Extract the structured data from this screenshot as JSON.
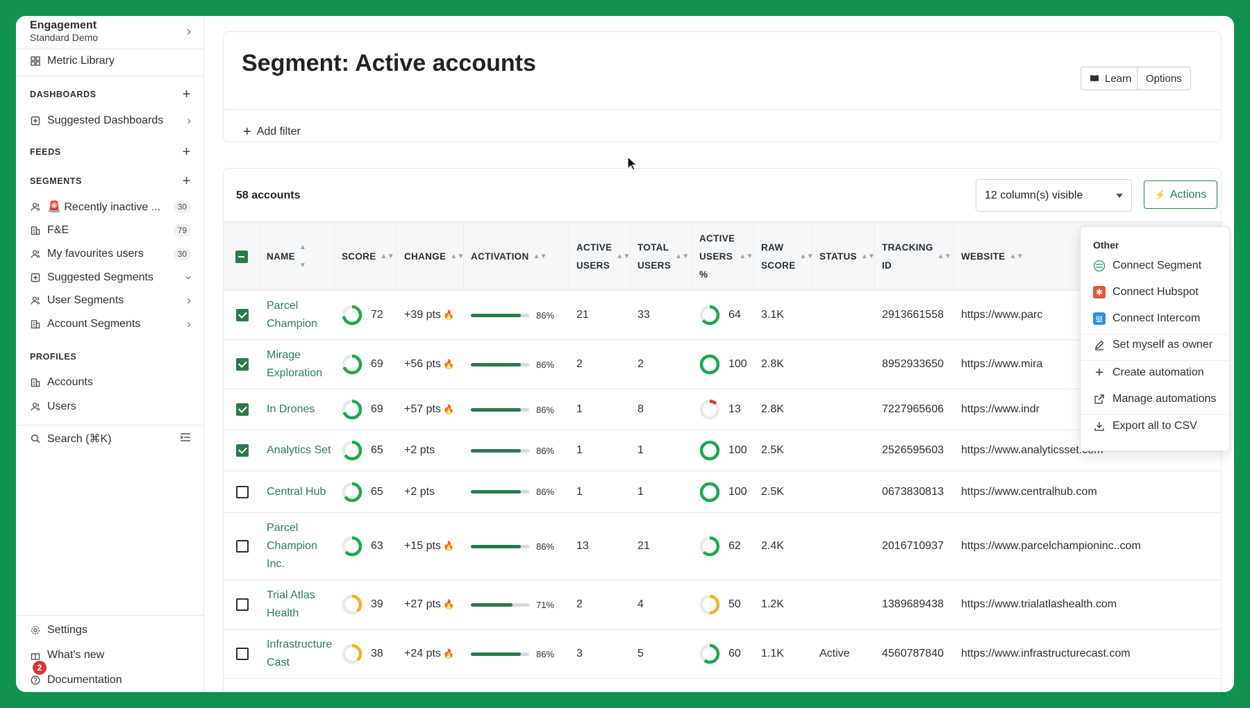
{
  "sidebar": {
    "workspace_name": "Engagement",
    "workspace_sub": "Standard Demo",
    "metric_library": "Metric Library",
    "dashboards_title": "DASHBOARDS",
    "suggested_dashboards": "Suggested Dashboards",
    "feeds_title": "FEEDS",
    "segments_title": "SEGMENTS",
    "segments": [
      {
        "label": "🚨 Recently inactive ...",
        "count": "30"
      },
      {
        "label": "F&E",
        "count": "79"
      },
      {
        "label": "My favourites users",
        "count": "30"
      },
      {
        "label": "Suggested Segments"
      },
      {
        "label": "User Segments"
      },
      {
        "label": "Account Segments"
      }
    ],
    "profiles_title": "PROFILES",
    "accounts": "Accounts",
    "users": "Users",
    "search": "Search (⌘K)",
    "settings": "Settings",
    "whats_new": "What's new",
    "whats_new_badge": "2",
    "documentation": "Documentation"
  },
  "header": {
    "title": "Segment: Active accounts",
    "learn": "Learn",
    "options": "Options",
    "add_filter": "Add filter"
  },
  "table": {
    "count_label": "58 accounts",
    "columns_visible": "12 column(s) visible",
    "actions": "Actions",
    "headers": {
      "name": "NAME",
      "score": "SCORE",
      "change": "CHANGE",
      "activation": "ACTIVATION",
      "active_users_1": "ACTIVE",
      "active_users_2": "USERS",
      "total_users_1": "TOTAL",
      "total_users_2": "USERS",
      "active_pct_1": "ACTIVE",
      "active_pct_2": "USERS",
      "active_pct_3": "%",
      "raw_score_1": "RAW",
      "raw_score_2": "SCORE",
      "status": "STATUS",
      "tracking_1": "TRACKING",
      "tracking_2": "ID",
      "website": "WEBSITE"
    },
    "rows": [
      {
        "checked": true,
        "name": "Parcel Champion",
        "score": "72",
        "score_pct": 72,
        "change": "+39 pts",
        "hot": true,
        "activation": "86%",
        "activation_pct": 86,
        "active_users": "21",
        "total_users": "33",
        "active_pct": "64",
        "active_pct_val": 64,
        "raw": "3.1K",
        "status": "",
        "tracking": "2913661558",
        "website": "https://www.parc"
      },
      {
        "checked": true,
        "name": "Mirage Exploration",
        "score": "69",
        "score_pct": 69,
        "change": "+56 pts",
        "hot": true,
        "activation": "86%",
        "activation_pct": 86,
        "active_users": "2",
        "total_users": "2",
        "active_pct": "100",
        "active_pct_val": 100,
        "raw": "2.8K",
        "status": "",
        "tracking": "8952933650",
        "website": "https://www.mira"
      },
      {
        "checked": true,
        "name": "In Drones",
        "score": "69",
        "score_pct": 69,
        "change": "+57 pts",
        "hot": true,
        "activation": "86%",
        "activation_pct": 86,
        "active_users": "1",
        "total_users": "8",
        "active_pct": "13",
        "active_pct_val": 13,
        "raw": "2.8K",
        "status": "",
        "tracking": "7227965606",
        "website": "https://www.indr"
      },
      {
        "checked": true,
        "name": "Analytics Set",
        "score": "65",
        "score_pct": 65,
        "change": "+2 pts",
        "hot": false,
        "activation": "86%",
        "activation_pct": 86,
        "active_users": "1",
        "total_users": "1",
        "active_pct": "100",
        "active_pct_val": 100,
        "raw": "2.5K",
        "status": "",
        "tracking": "2526595603",
        "website": "https://www.analyticsset.com"
      },
      {
        "checked": false,
        "name": "Central Hub",
        "score": "65",
        "score_pct": 65,
        "change": "+2 pts",
        "hot": false,
        "activation": "86%",
        "activation_pct": 86,
        "active_users": "1",
        "total_users": "1",
        "active_pct": "100",
        "active_pct_val": 100,
        "raw": "2.5K",
        "status": "",
        "tracking": "0673830813",
        "website": "https://www.centralhub.com"
      },
      {
        "checked": false,
        "name": "Parcel Champion Inc.",
        "score": "63",
        "score_pct": 63,
        "change": "+15 pts",
        "hot": true,
        "activation": "86%",
        "activation_pct": 86,
        "active_users": "13",
        "total_users": "21",
        "active_pct": "62",
        "active_pct_val": 62,
        "raw": "2.4K",
        "status": "",
        "tracking": "2016710937",
        "website": "https://www.parcelchampioninc..com"
      },
      {
        "checked": false,
        "name": "Trial Atlas Health",
        "score": "39",
        "score_pct": 39,
        "change": "+27 pts",
        "hot": true,
        "activation": "71%",
        "activation_pct": 71,
        "active_users": "2",
        "total_users": "4",
        "active_pct": "50",
        "active_pct_val": 50,
        "raw": "1.2K",
        "status": "",
        "tracking": "1389689438",
        "website": "https://www.trialatlashealth.com"
      },
      {
        "checked": false,
        "name": "Infrastructure Cast",
        "score": "38",
        "score_pct": 38,
        "change": "+24 pts",
        "hot": true,
        "activation": "86%",
        "activation_pct": 86,
        "active_users": "3",
        "total_users": "5",
        "active_pct": "60",
        "active_pct_val": 60,
        "raw": "1.1K",
        "status": "Active",
        "tracking": "4560787840",
        "website": "https://www.infrastructurecast.com"
      }
    ]
  },
  "dropdown": {
    "heading": "Other",
    "items": [
      {
        "label": "Connect Segment",
        "icon": "segment-icon"
      },
      {
        "label": "Connect Hubspot",
        "icon": "hubspot-icon"
      },
      {
        "label": "Connect Intercom",
        "icon": "intercom-icon"
      },
      {
        "label": "Set myself as owner",
        "icon": "pencil-icon"
      },
      {
        "label": "Create automation",
        "icon": "plus-icon"
      },
      {
        "label": "Manage automations",
        "icon": "external-link-icon"
      },
      {
        "label": "Export all to CSV",
        "icon": "download-icon"
      }
    ]
  },
  "colors": {
    "brand_green": "#0f9152",
    "link_green": "#2f7d50",
    "ring_green": "#1fa74f",
    "ring_yellow": "#f0b429",
    "ring_red": "#d23b3b",
    "hubspot": "#e8553a",
    "intercom": "#2f8ee0"
  }
}
